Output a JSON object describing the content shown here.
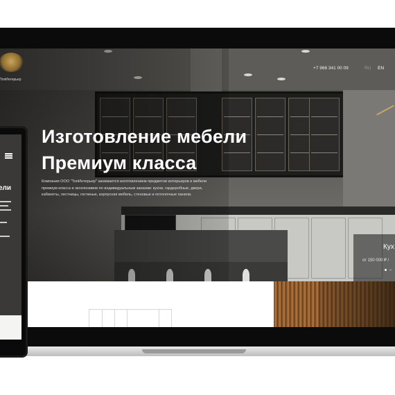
{
  "header": {
    "logo_text": "ТопИнтерьер",
    "phone": "+7 966 341 00 09",
    "lang_ru": "RU",
    "lang_en": "EN"
  },
  "hero": {
    "title_line1": "Изготовление мебели",
    "title_line2": "Премиум класса",
    "description": "Компания ООО \"ТопИнтерьер\" занимается изготовлением предметов интерьеров и мебели премиум класса и эксклюзивов по индивидуальным заказам: кухни, гардеробные, двери, кабинеты, лестницы, гостиные, корпусная мебель, стеновые и потолочные панели."
  },
  "slide_card": {
    "title": "Кух",
    "price": "от 150 000 ₽ /"
  },
  "phone_view": {
    "title_fragment": "ели"
  },
  "colors": {
    "accent_gold": "#c9a45c",
    "dark_frame": "#0b0b0b"
  }
}
